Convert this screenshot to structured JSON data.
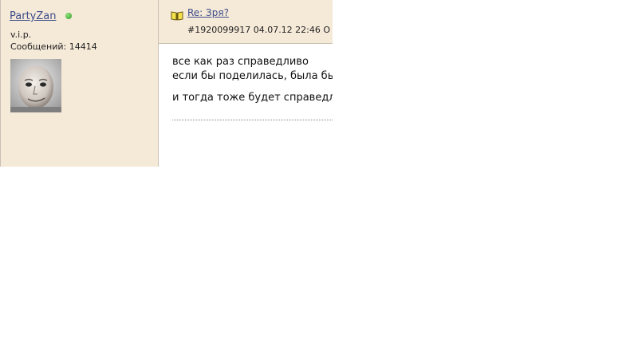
{
  "author": {
    "name": "PartyZan",
    "status_color": "#3aa12b",
    "rank": "v.i.p.",
    "posts_label": "Сообщений: 14414"
  },
  "post": {
    "icon": "book-icon",
    "title": "Re: Зря?",
    "meta": "#1920099917 04.07.12 22:46 О",
    "body_lines": [
      "все как раз справедливо",
      "если бы поделилась, была бы",
      "и тогда тоже будет справедли"
    ]
  }
}
